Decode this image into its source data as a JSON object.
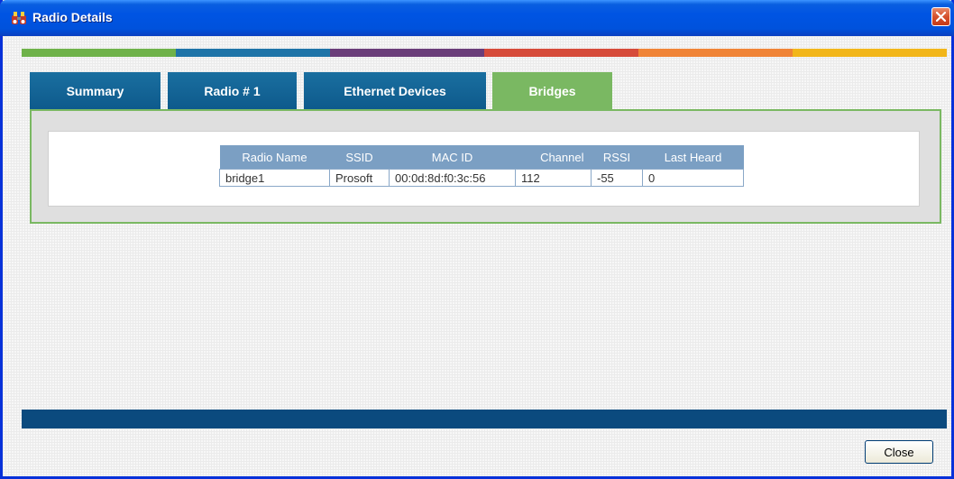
{
  "window": {
    "title": "Radio Details",
    "icon": "binoculars-icon",
    "close_icon": "close-icon"
  },
  "stripe_colors": [
    "#6fb24a",
    "#1f74a8",
    "#6b3e7a",
    "#d64b3a",
    "#f08437",
    "#f2b61a"
  ],
  "tabs": [
    {
      "label": "Summary",
      "active": false
    },
    {
      "label": "Radio # 1",
      "active": false
    },
    {
      "label": "Ethernet Devices",
      "active": false
    },
    {
      "label": "Bridges",
      "active": true
    }
  ],
  "bridges_table": {
    "columns": [
      "Radio Name",
      "SSID",
      "MAC ID",
      "Channel",
      "RSSI",
      "Last Heard"
    ],
    "rows": [
      [
        "bridge1",
        "Prosoft",
        "00:0d:8d:f0:3c:56",
        "112",
        "-55",
        "0"
      ]
    ]
  },
  "footer": {
    "close_label": "Close"
  },
  "colors": {
    "tab_blue": "#0e5a8c",
    "tab_active": "#7ab862",
    "table_header": "#7b9fc3",
    "footer_bar": "#0b4a7e"
  }
}
